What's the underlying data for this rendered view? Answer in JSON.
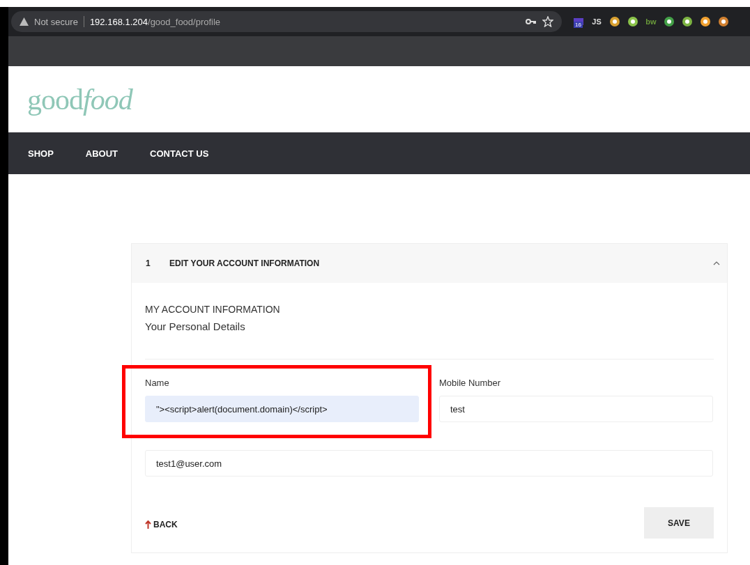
{
  "browser": {
    "security": "Not secure",
    "url_host": "192.168.1.204",
    "url_path": "/good_food/profile",
    "extensions": [
      {
        "kind": "badge",
        "text": "16"
      },
      {
        "kind": "text",
        "text": "JS"
      },
      {
        "kind": "icon"
      },
      {
        "kind": "icon"
      },
      {
        "kind": "text",
        "text": "bw"
      },
      {
        "kind": "icon"
      },
      {
        "kind": "icon"
      },
      {
        "kind": "icon"
      },
      {
        "kind": "icon"
      }
    ]
  },
  "site": {
    "logo": {
      "plain": "good",
      "italic": "food"
    },
    "nav": [
      {
        "label": "SHOP"
      },
      {
        "label": "ABOUT"
      },
      {
        "label": "CONTACT US"
      }
    ]
  },
  "panel": {
    "step": "1",
    "title": "EDIT YOUR ACCOUNT INFORMATION",
    "expanded": true,
    "section": "MY ACCOUNT INFORMATION",
    "subtitle": "Your Personal Details",
    "fields": [
      {
        "label": "Name",
        "value": "\"><script>alert(document.domain)</script>",
        "autofilled": true,
        "highlighted": true
      },
      {
        "label": "Mobile Number",
        "value": "test",
        "autofilled": false,
        "highlighted": false
      },
      {
        "value": "test1@user.com",
        "autofilled": false,
        "highlighted": false
      }
    ],
    "back": "BACK",
    "save": "SAVE"
  }
}
